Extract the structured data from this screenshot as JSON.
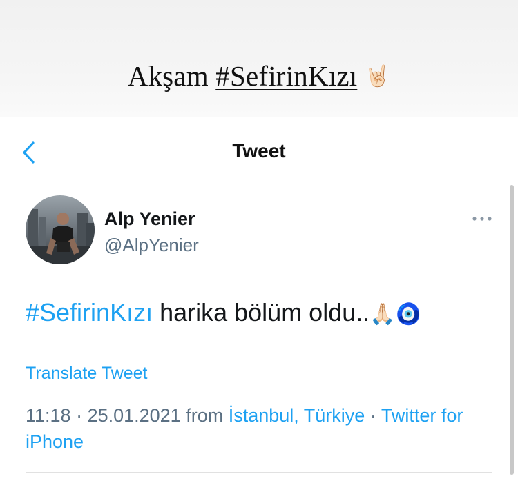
{
  "story": {
    "caption_prefix": "Akşam ",
    "caption_hashtag": "#SefirinKızı",
    "caption_emoji": "🤘🏻"
  },
  "nav": {
    "back_icon": "chevron-left-icon",
    "title": "Tweet"
  },
  "tweet": {
    "author_name": "Alp Yenier",
    "author_handle": "@AlpYenier",
    "more_icon": "more-horizontal-icon",
    "hashtag": "#SefirinKızı",
    "body": " harika bölüm oldu..",
    "emojis": "🙏🏻🧿",
    "translate_label": "Translate Tweet",
    "time": "11:18",
    "separator": " · ",
    "date": "25.01.2021",
    "from_text": " from ",
    "location": "İstanbul, Türkiye",
    "source": "Twitter for iPhone"
  },
  "colors": {
    "link_blue": "#1da1f2",
    "secondary_text": "#5b7083",
    "primary_text": "#14171a"
  }
}
